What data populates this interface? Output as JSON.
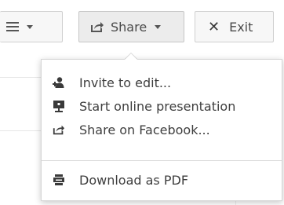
{
  "toolbar": {
    "share_label": "Share",
    "exit_label": "Exit",
    "exit_symbol": "✕"
  },
  "share_menu": {
    "items": [
      {
        "label": "Invite to edit...",
        "icon": "add-user-icon"
      },
      {
        "label": "Start online presentation",
        "icon": "presentation-icon"
      },
      {
        "label": "Share on Facebook...",
        "icon": "share-icon"
      },
      {
        "label": "Download as PDF",
        "icon": "printer-icon"
      }
    ]
  },
  "colors": {
    "button_bg": "#f5f5f5",
    "button_active_bg": "#ececec",
    "icon": "#3a3a3a",
    "text": "#4a4a4a"
  }
}
